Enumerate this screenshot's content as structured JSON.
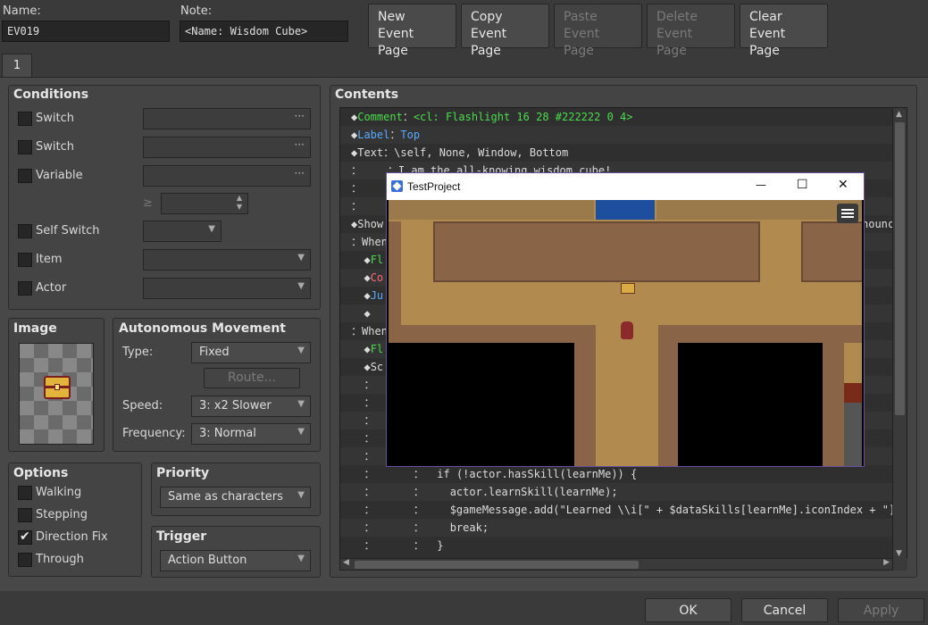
{
  "header": {
    "name_label": "Name:",
    "name_value": "EV019",
    "note_label": "Note:",
    "note_value": "<Name: Wisdom Cube>"
  },
  "toolbar": {
    "new_event_page": "New\nEvent Page",
    "copy_event_page": "Copy\nEvent Page",
    "paste_event_page": "Paste\nEvent Page",
    "delete_event_page": "Delete\nEvent Page",
    "clear_event_page": "Clear\nEvent Page"
  },
  "tabs": [
    {
      "label": "1"
    }
  ],
  "conditions": {
    "title": "Conditions",
    "items": [
      {
        "label": "Switch",
        "checked": false
      },
      {
        "label": "Switch",
        "checked": false
      },
      {
        "label": "Variable",
        "checked": false
      },
      {
        "label": "Self Switch",
        "checked": false
      },
      {
        "label": "Item",
        "checked": false
      },
      {
        "label": "Actor",
        "checked": false
      }
    ],
    "ge_symbol": "≥"
  },
  "image": {
    "title": "Image"
  },
  "autonomous": {
    "title": "Autonomous Movement",
    "type_label": "Type:",
    "type_value": "Fixed",
    "route_label": "Route...",
    "speed_label": "Speed:",
    "speed_value": "3: x2 Slower",
    "freq_label": "Frequency:",
    "freq_value": "3: Normal"
  },
  "options": {
    "title": "Options",
    "items": [
      {
        "label": "Walking",
        "checked": false
      },
      {
        "label": "Stepping",
        "checked": false
      },
      {
        "label": "Direction Fix",
        "checked": true
      },
      {
        "label": "Through",
        "checked": false
      }
    ]
  },
  "priority": {
    "title": "Priority",
    "value": "Same as characters"
  },
  "trigger": {
    "title": "Trigger",
    "value": "Action Button"
  },
  "contents": {
    "title": "Contents",
    "lines": [
      {
        "prefix": "◆",
        "cmd": "Comment",
        "sep": "：",
        "text": "<cl: Flashlight 16 28 #222222 0 4>",
        "color": "green"
      },
      {
        "prefix": "◆",
        "cmd": "Label",
        "sep": "：",
        "text": "Top",
        "color": "blue"
      },
      {
        "prefix": "◆",
        "cmd": "Text",
        "sep": "：",
        "text": "\\self, None, Window, Bottom",
        "color": "plain"
      },
      {
        "prefix": "：",
        "cmd": "",
        "sep": "    ：",
        "text": "I am the all-knowing wisdom cube!",
        "color": "plain"
      },
      {
        "prefix": "：",
        "cmd": "",
        "sep": "",
        "text": "",
        "color": "plain"
      },
      {
        "prefix": "：",
        "cmd": "",
        "sep": "",
        "text": "",
        "color": "plain"
      },
      {
        "prefix": "◆",
        "cmd": "Show",
        "sep": "",
        "text": "",
        "tail": "nounc",
        "color": "plain"
      },
      {
        "prefix": "：",
        "cmd": "When",
        "sep": "",
        "text": "",
        "color": "plain"
      },
      {
        "prefix": "  ◆",
        "cmd": "Fl",
        "sep": "",
        "text": "",
        "color": "green"
      },
      {
        "prefix": "  ◆",
        "cmd": "Co",
        "sep": "",
        "text": "",
        "color": "red"
      },
      {
        "prefix": "  ◆",
        "cmd": "Ju",
        "sep": "",
        "text": "",
        "color": "blue"
      },
      {
        "prefix": "  ◆",
        "cmd": "",
        "sep": "",
        "text": "",
        "color": "plain"
      },
      {
        "prefix": "：",
        "cmd": "When",
        "sep": "",
        "text": "",
        "color": "plain"
      },
      {
        "prefix": "  ◆",
        "cmd": "Fl",
        "sep": "",
        "text": "",
        "color": "green"
      },
      {
        "prefix": "  ◆",
        "cmd": "Sc",
        "sep": "",
        "text": "",
        "color": "plain"
      },
      {
        "prefix": "  ：",
        "cmd": "",
        "sep": "",
        "text": "",
        "color": "plain"
      },
      {
        "prefix": "  ：",
        "cmd": "",
        "sep": "",
        "text": "",
        "color": "plain"
      },
      {
        "prefix": "  ：",
        "cmd": "",
        "sep": "",
        "text": "",
        "color": "plain"
      },
      {
        "prefix": "  ：",
        "cmd": "",
        "sep": "",
        "text": "",
        "color": "plain"
      },
      {
        "prefix": "  ：",
        "cmd": "",
        "sep": "",
        "text": "",
        "color": "plain"
      },
      {
        "prefix": "  ：",
        "cmd": "",
        "sep": "      ：  ",
        "text": "if (!actor.hasSkill(learnMe)) {",
        "color": "plain"
      },
      {
        "prefix": "  ：",
        "cmd": "",
        "sep": "      ：    ",
        "text": "actor.learnSkill(learnMe);",
        "color": "plain"
      },
      {
        "prefix": "  ：",
        "cmd": "",
        "sep": "      ：    ",
        "text": "$gameMessage.add(\"Learned \\\\i[\" + $dataSkills[learnMe].iconIndex + \"]\"",
        "color": "plain"
      },
      {
        "prefix": "  ：",
        "cmd": "",
        "sep": "      ：    ",
        "text": "break;",
        "color": "plain"
      },
      {
        "prefix": "  ：",
        "cmd": "",
        "sep": "      ：  ",
        "text": "}",
        "color": "plain"
      }
    ]
  },
  "game_window": {
    "title": "TestProject",
    "minimize_glyph": "—",
    "maximize_glyph": "☐",
    "close_glyph": "✕"
  },
  "footer": {
    "ok": "OK",
    "cancel": "Cancel",
    "apply": "Apply"
  }
}
